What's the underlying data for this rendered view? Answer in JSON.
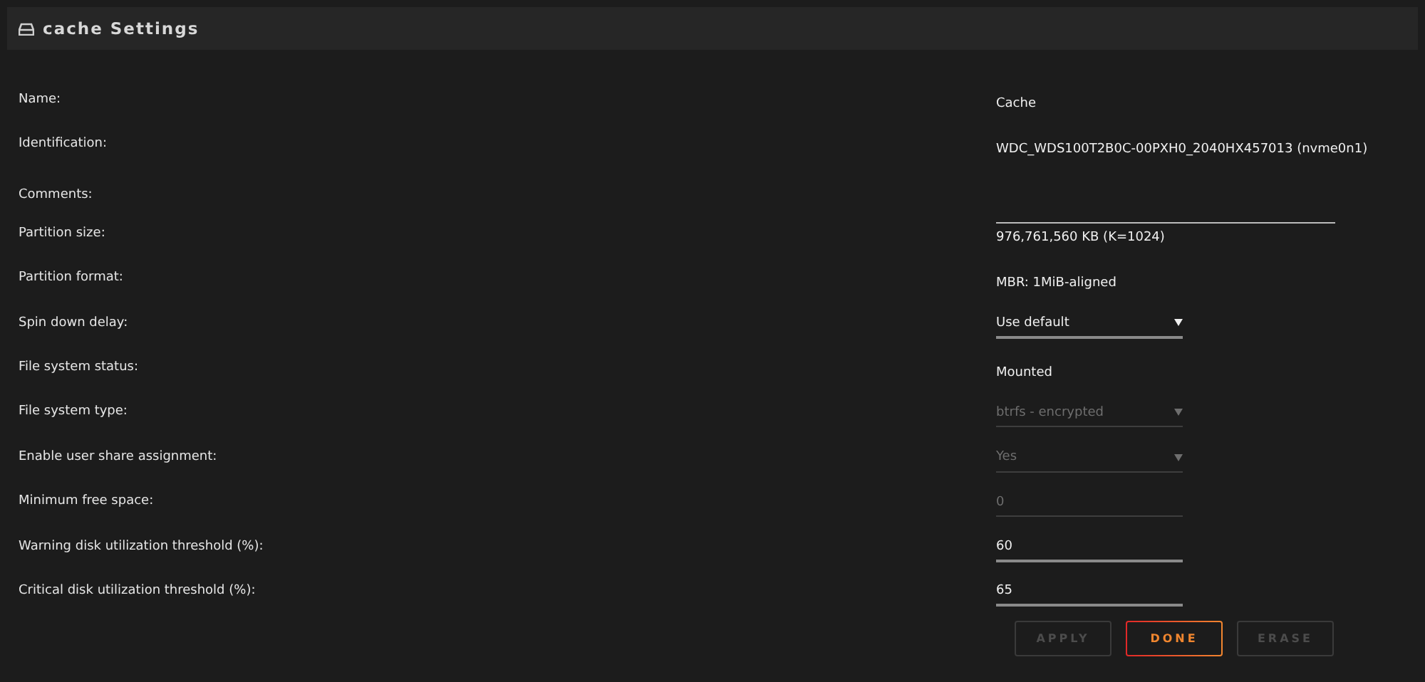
{
  "header": {
    "title": "cache Settings"
  },
  "rows": [
    {
      "label": "Name:",
      "kind": "text",
      "value": "Cache"
    },
    {
      "label": "Identification:",
      "kind": "text",
      "value": "WDC_WDS100T2B0C-00PXH0_2040HX457013 (nvme0n1)"
    },
    {
      "label": "Comments:",
      "kind": "comment"
    },
    {
      "label": "Partition size:",
      "kind": "text",
      "value": "976,761,560 KB (K=1024)"
    },
    {
      "label": "Partition format:",
      "kind": "text",
      "value": "MBR: 1MiB-aligned"
    },
    {
      "label": "Spin down delay:",
      "kind": "select",
      "value": "Use default",
      "disabled": false
    },
    {
      "label": "File system status:",
      "kind": "text",
      "value": "Mounted"
    },
    {
      "label": "File system type:",
      "kind": "select",
      "value": "btrfs - encrypted",
      "disabled": true
    },
    {
      "label": "Enable user share assignment:",
      "kind": "select",
      "value": "Yes",
      "disabled": true
    },
    {
      "label": "Minimum free space:",
      "kind": "field",
      "value": "0",
      "disabled": true
    },
    {
      "label": "Warning disk utilization threshold (%):",
      "kind": "field",
      "value": "60",
      "disabled": false
    },
    {
      "label": "Critical disk utilization threshold (%):",
      "kind": "field",
      "value": "65",
      "disabled": false
    }
  ],
  "buttons": [
    {
      "label": "APPLY",
      "disabled": true,
      "kind": "plain"
    },
    {
      "label": "DONE",
      "disabled": false,
      "kind": "primary"
    },
    {
      "label": "ERASE",
      "disabled": true,
      "kind": "plain"
    }
  ]
}
